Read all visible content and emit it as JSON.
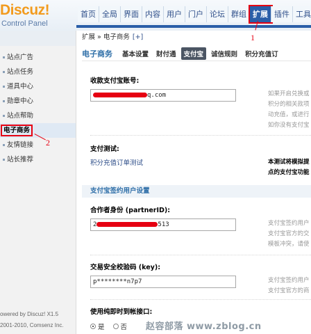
{
  "brand": {
    "logo": "Discuz!",
    "subtitle": "Control Panel"
  },
  "top_nav": {
    "items": [
      {
        "label": "首页"
      },
      {
        "label": "全局"
      },
      {
        "label": "界面"
      },
      {
        "label": "内容"
      },
      {
        "label": "用户"
      },
      {
        "label": "门户"
      },
      {
        "label": "论坛"
      },
      {
        "label": "群组"
      },
      {
        "label": "扩展",
        "active": true
      },
      {
        "label": "插件"
      },
      {
        "label": "工具"
      }
    ]
  },
  "sidebar": {
    "items": [
      {
        "label": "站点广告"
      },
      {
        "label": "站点任务"
      },
      {
        "label": "道具中心"
      },
      {
        "label": "勋章中心"
      },
      {
        "label": "站点帮助"
      },
      {
        "label": "电子商务",
        "active": true
      },
      {
        "label": "友情链接"
      },
      {
        "label": "站长推荐"
      }
    ],
    "footer_line1": "owered by Discuz! X1.5",
    "footer_line2": "2001-2010, Comsenz Inc."
  },
  "breadcrumb": {
    "path": "扩展 » 电子商务",
    "add": "[+]"
  },
  "main": {
    "section_title": "电子商务",
    "subtabs": [
      {
        "label": "基本设置"
      },
      {
        "label": "财付通"
      },
      {
        "label": "支付宝",
        "active": true
      },
      {
        "label": "诚信规则"
      },
      {
        "label": "积分充值订"
      }
    ],
    "account_label": "收款支付宝账号:",
    "account_value_tail": "q.com",
    "account_tip1": "如果开启兑换或",
    "account_tip2": "积分的相关款项",
    "account_tip3": "动充值，或进行",
    "account_tip4": "如你没有支付宝",
    "test_label": "支付测试:",
    "test_link": "积分充值订单测试",
    "test_tip1": "本测试将模拟提",
    "test_tip2": "点的支付宝功能",
    "signed_header": "支付宝签约用户设置",
    "partner_label": "合作者身份 (partnerID):",
    "partner_prefix": "2",
    "partner_suffix": "513",
    "partner_tip1": "支付宝签约用户",
    "partner_tip2": "支付宝官方的交",
    "partner_tip3": "模板冲突，请使",
    "key_label": "交易安全校验码 (key):",
    "key_value": "p********n7p7",
    "key_tip1": "支付宝签约用户",
    "key_tip2": "支付宝官方的商",
    "direct_label": "使用纯即时到帐接口:",
    "radio_yes": "是",
    "radio_no": "否"
  },
  "annotations": {
    "step1": "1",
    "step2": "2"
  },
  "watermark": "赵容部落 www.zblog.cn",
  "colors": {
    "accent": "#2a5ea8",
    "annotation": "#e60012",
    "logo": "#f29b1e"
  }
}
